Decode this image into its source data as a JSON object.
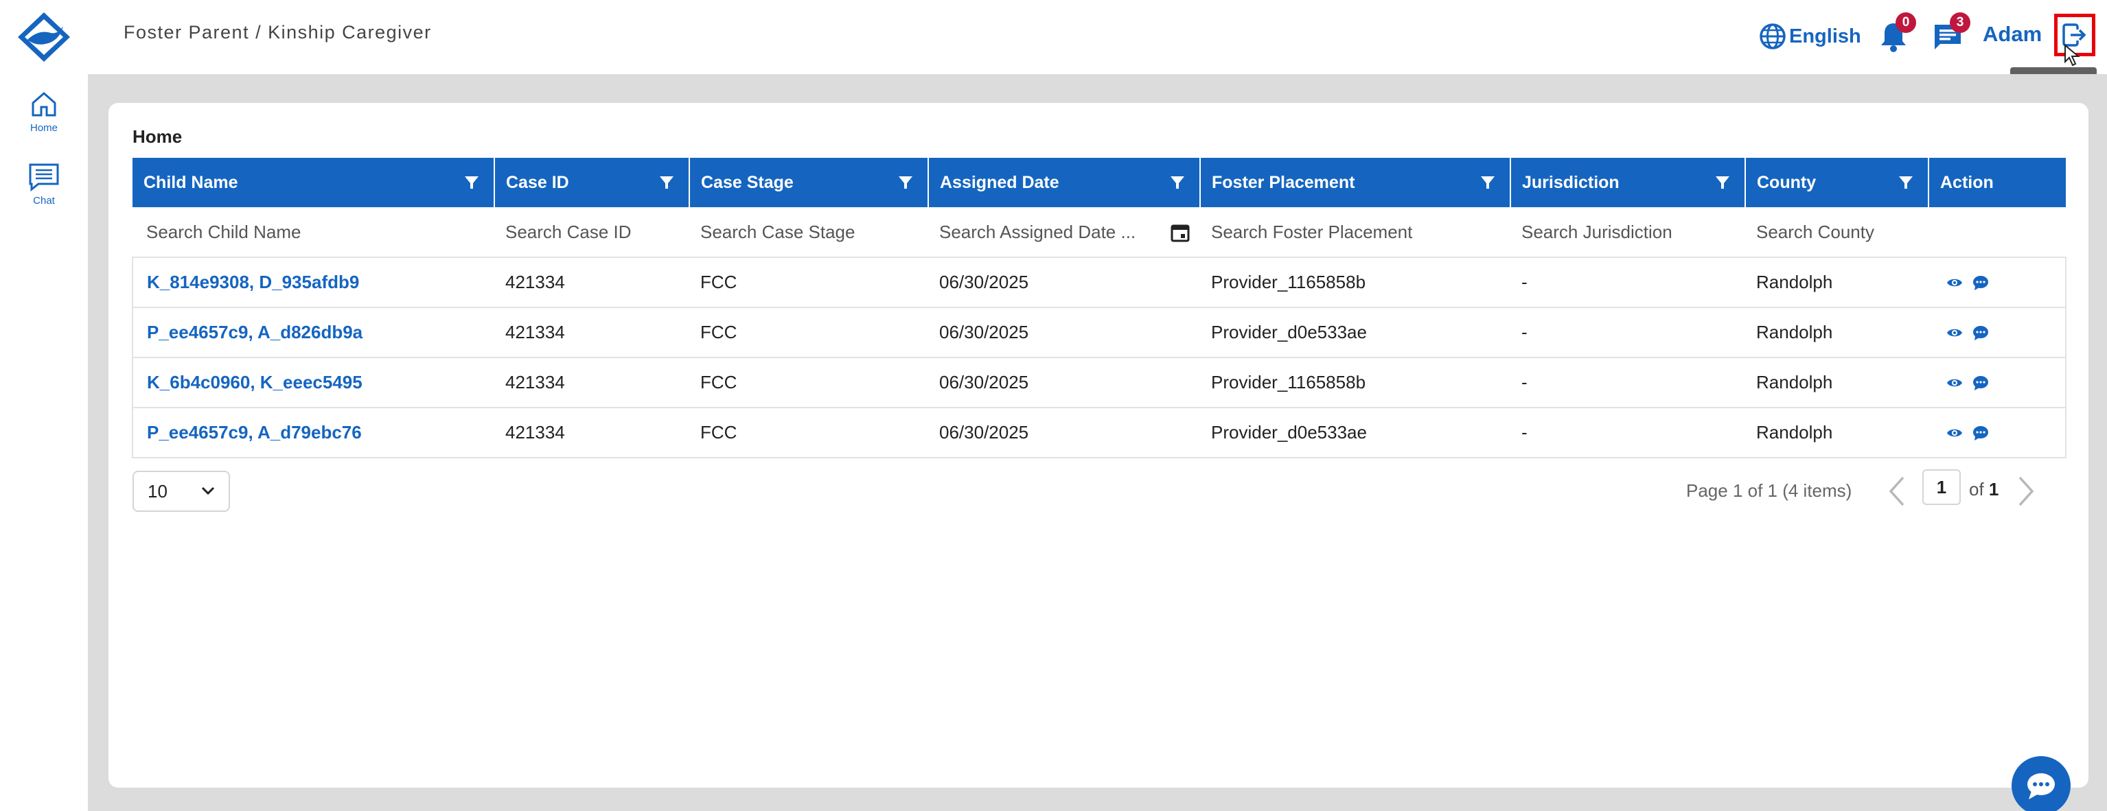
{
  "header": {
    "title": "Foster Parent / Kinship Caregiver",
    "language": "English",
    "notifications_count": "0",
    "messages_count": "3",
    "user_name": "Adam",
    "logout_tooltip": "Logout"
  },
  "sidebar": {
    "items": [
      {
        "label": "Home",
        "icon": "home-icon"
      },
      {
        "label": "Chat",
        "icon": "chat-icon"
      }
    ]
  },
  "main": {
    "title": "Home",
    "columns": [
      "Child Name",
      "Case ID",
      "Case Stage",
      "Assigned Date",
      "Foster Placement",
      "Jurisdiction",
      "County",
      "Action"
    ],
    "search_placeholders": [
      "Search Child Name",
      "Search Case ID",
      "Search Case Stage",
      "Search Assigned Date ...",
      "Search Foster Placement",
      "Search Jurisdiction",
      "Search County"
    ],
    "rows": [
      {
        "child_name": "K_814e9308, D_935afdb9",
        "case_id": "421334",
        "case_stage": "FCC",
        "assigned_date": "06/30/2025",
        "foster_placement": "Provider_1165858b",
        "jurisdiction": "-",
        "county": "Randolph"
      },
      {
        "child_name": "P_ee4657c9, A_d826db9a",
        "case_id": "421334",
        "case_stage": "FCC",
        "assigned_date": "06/30/2025",
        "foster_placement": "Provider_d0e533ae",
        "jurisdiction": "-",
        "county": "Randolph"
      },
      {
        "child_name": "K_6b4c0960, K_eeec5495",
        "case_id": "421334",
        "case_stage": "FCC",
        "assigned_date": "06/30/2025",
        "foster_placement": "Provider_1165858b",
        "jurisdiction": "-",
        "county": "Randolph"
      },
      {
        "child_name": "P_ee4657c9, A_d79ebc76",
        "case_id": "421334",
        "case_stage": "FCC",
        "assigned_date": "06/30/2025",
        "foster_placement": "Provider_d0e533ae",
        "jurisdiction": "-",
        "county": "Randolph"
      }
    ]
  },
  "pager": {
    "page_size": "10",
    "summary": "Page 1 of 1 (4 items)",
    "current_page": "1",
    "of_label": "of",
    "total_pages": "1"
  },
  "colors": {
    "primary": "#1565c0",
    "badge": "#c0173f",
    "highlight": "#e8000b",
    "canvas": "#dcdcdc"
  }
}
